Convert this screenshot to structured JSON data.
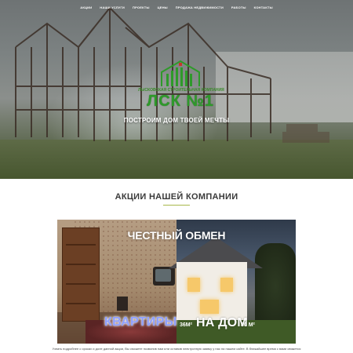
{
  "nav": {
    "items": [
      "АКЦИИ",
      "НАШИ УСЛУГИ",
      "ПРОЕКТЫ",
      "ЦЕНЫ",
      "ПРОДАЖА НЕДВИЖИМОСТИ",
      "РАБОТЫ",
      "КОНТАКТЫ"
    ],
    "active_index": 0
  },
  "hero": {
    "logo_tagline": "ЛЫСКОВСКАЯ СТРОИТЕЛЬНАЯ КОМПАНИЯ",
    "logo_name": "ЛСК №1",
    "slogan": "ПОСТРОИМ ДОМ ТВОЕЙ МЕЧТЫ"
  },
  "promo": {
    "section_title": "АКЦИИ НАШЕЙ КОМПАНИИ",
    "banner": {
      "headline": "ЧЕСТНЫЙ ОБМЕН",
      "flats": "КВАРТИРЫ",
      "area1": "36М²",
      "house": "НА ДОМ",
      "area2": "80 М²"
    },
    "note": "Узнать подробнее о сроках и доле данной акции, Вы сможете позвонив нам или оставив электронную заявку у нас на нашем сайте. В ближайшее время с вами свяжется"
  },
  "colors": {
    "accent": "#a8b84a",
    "logo_green": "#2e9a2a",
    "flats_text": "#8fa0ff"
  }
}
